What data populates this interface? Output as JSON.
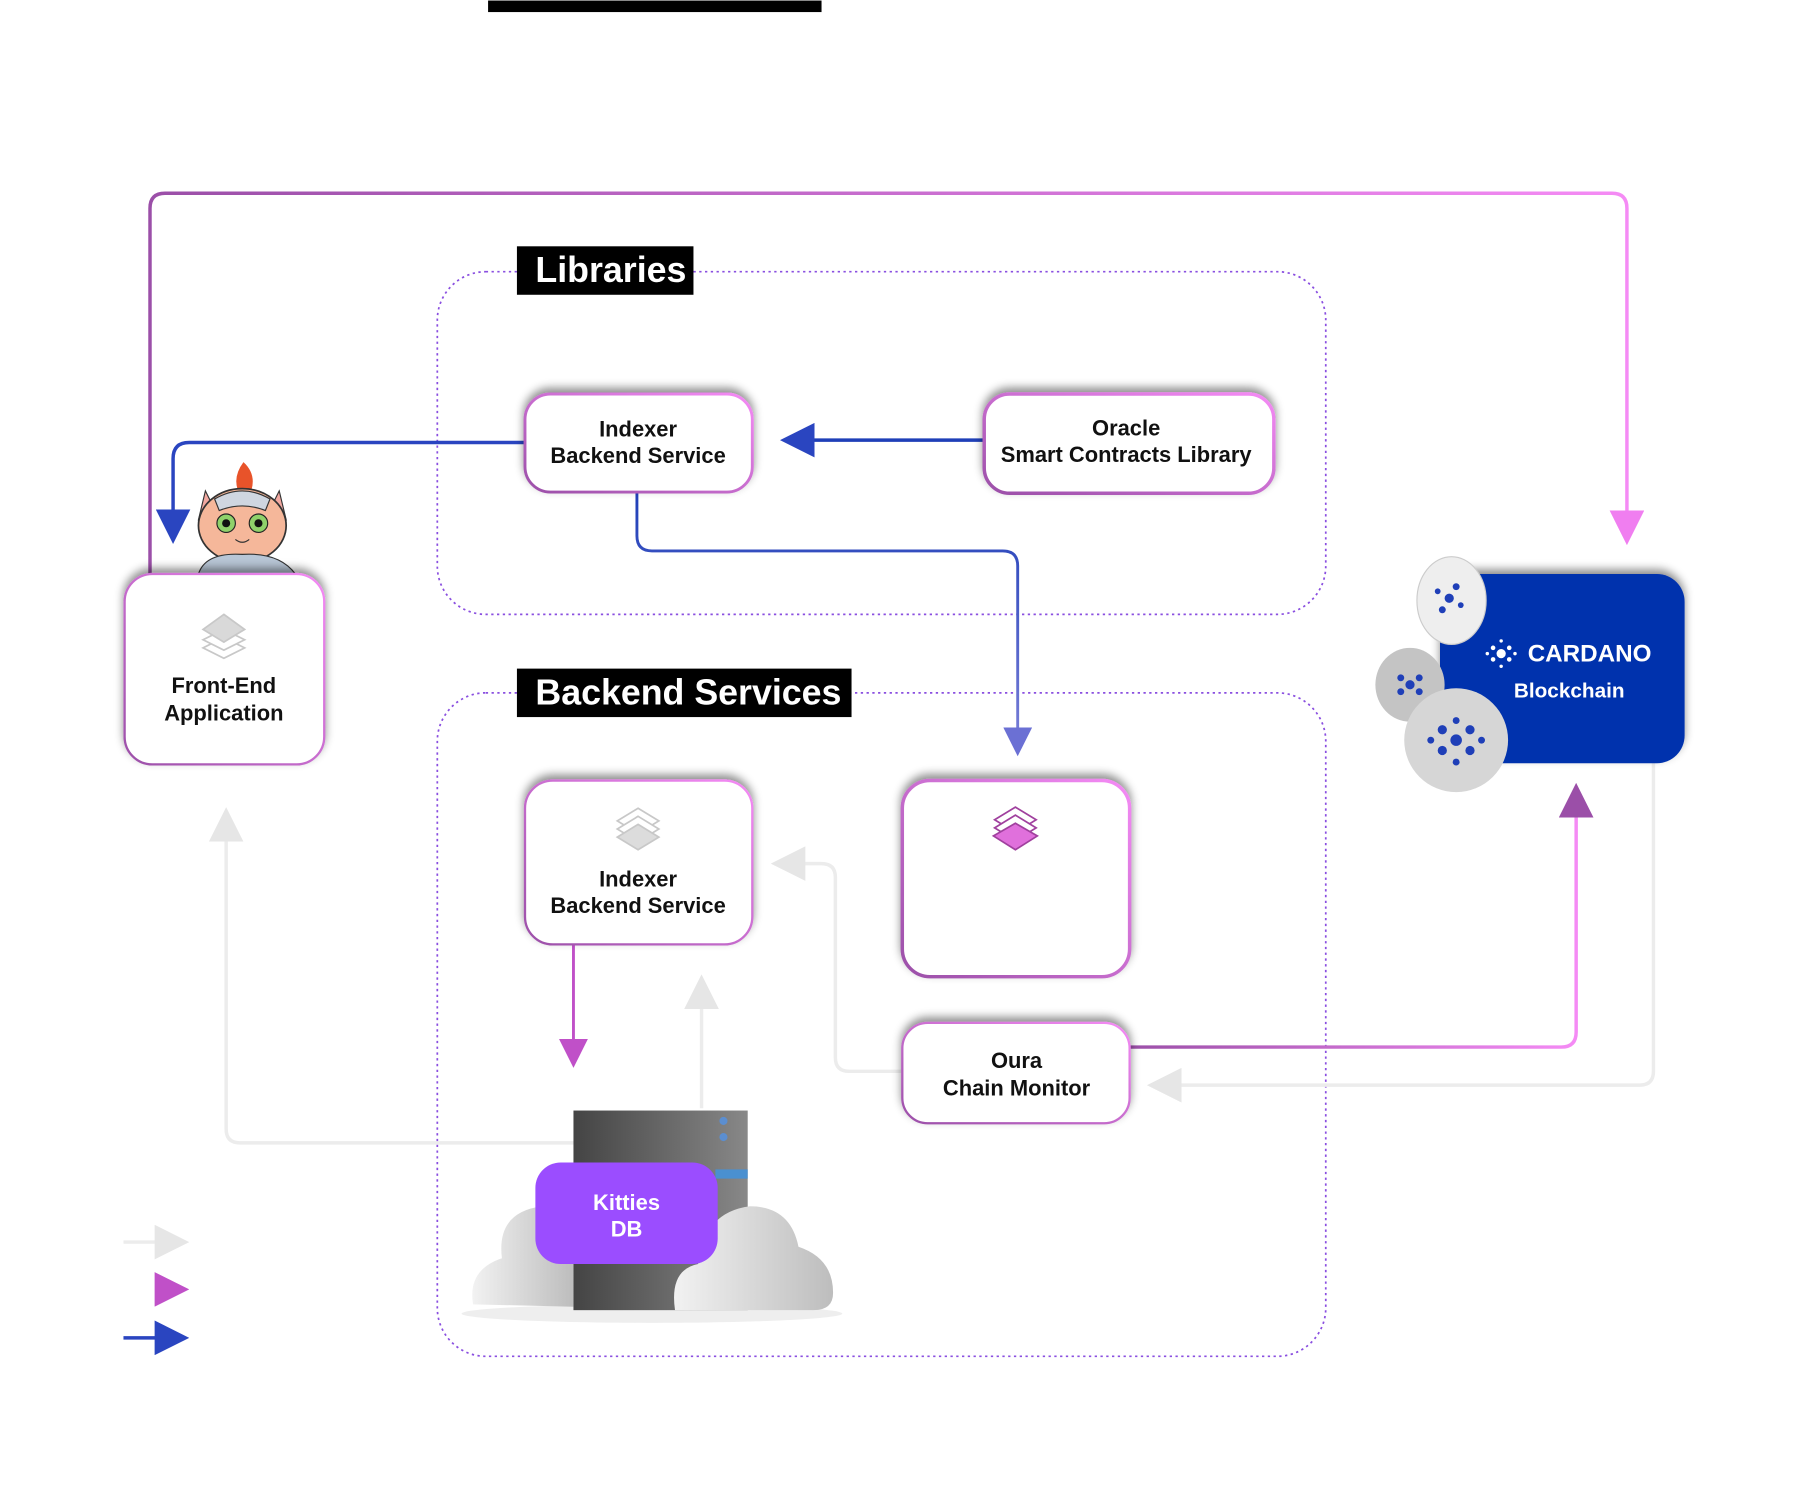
{
  "groups": {
    "libraries": {
      "title": "Libraries"
    },
    "backend": {
      "title": "Backend Services"
    }
  },
  "nodes": {
    "indexer_lib": {
      "line1": "Indexer",
      "line2": "Backend Service"
    },
    "oracle": {
      "line1": "Oracle",
      "line2": "Smart Contracts Library"
    },
    "frontend": {
      "line1": "Front-End",
      "line2": "Application"
    },
    "indexer_svc": {
      "line1": "Indexer",
      "line2": "Backend Service"
    },
    "oura": {
      "line1": "Oura",
      "line2": "Chain Monitor"
    },
    "db": {
      "line1": "Kitties",
      "line2": "DB"
    },
    "cardano": {
      "brand": "CARDANO",
      "line2": "Blockchain"
    }
  },
  "colors": {
    "blue_flow": "#1f3fb8",
    "pink_flow": "#e07be8",
    "purple_flow": "#9b4fa8",
    "gray_flow": "#e8e8e8",
    "cardano_blue": "#0033ad",
    "db_purple": "#9b4dff",
    "group_border": "#8a4fe0"
  },
  "icons": [
    "layers-icon",
    "cardano-logo-icon",
    "cat-mascot",
    "server-icon",
    "cloud-icon"
  ]
}
